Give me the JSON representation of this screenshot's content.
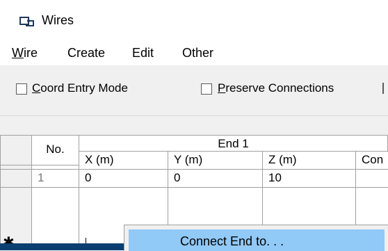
{
  "window": {
    "title": "Wires",
    "icon": "wire-window-icon"
  },
  "menu": {
    "items": [
      {
        "label": "Wire",
        "mnemonic": "W"
      },
      {
        "label": "Create",
        "mnemonic": "C"
      },
      {
        "label": "Edit",
        "mnemonic": "E"
      },
      {
        "label": "Other",
        "mnemonic": "O"
      }
    ]
  },
  "options": {
    "coord_entry_mode": {
      "label_first": "C",
      "label_rest": "oord Entry Mode",
      "checked": false
    },
    "preserve_connections": {
      "label_first": "P",
      "label_rest": "reserve Connections",
      "checked": false
    }
  },
  "table": {
    "header_no": "No.",
    "header_group": "End 1",
    "columns": [
      "X (m)",
      "Y (m)",
      "Z (m)",
      "Con"
    ],
    "rows": [
      {
        "no": "1",
        "x": "0",
        "y": "0",
        "z": "10",
        "con": ""
      }
    ],
    "new_row_marker": "✱"
  },
  "context_menu": {
    "items": [
      {
        "label": "Connect End to. . ."
      }
    ]
  },
  "colors": {
    "menu_highlight": "#91c9f7",
    "toolbar_bg": "#f0f0f0",
    "bottom_bar": "#0b3f72"
  }
}
